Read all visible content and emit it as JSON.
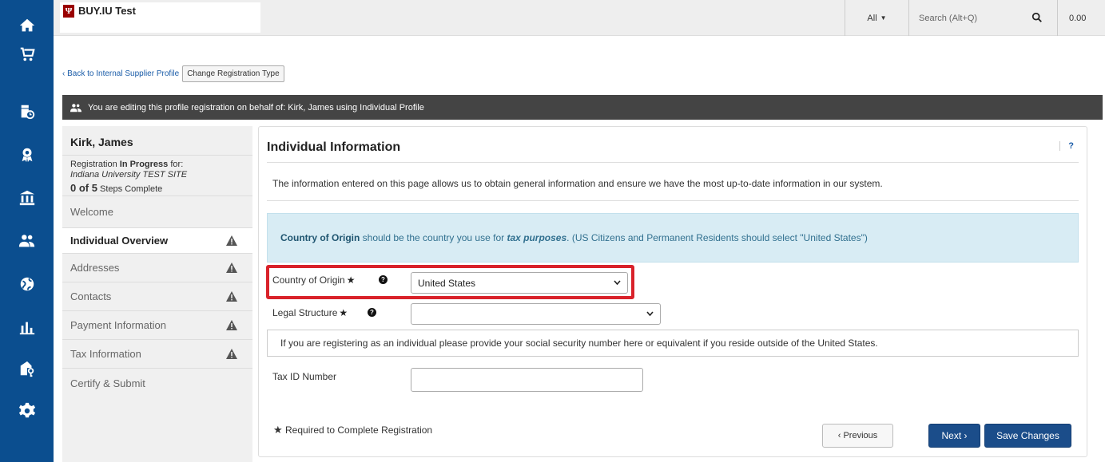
{
  "app": {
    "brand_logo": "Ψ",
    "brand_name": "BUY.IU Test"
  },
  "rail": {
    "icons": [
      "home-icon",
      "cart-icon",
      "documents-clock-icon",
      "award-icon",
      "bank-icon",
      "people-icon",
      "globe-icon",
      "bar-chart-icon",
      "building-key-icon",
      "gear-icon"
    ]
  },
  "search": {
    "scope_label": "All",
    "placeholder": "Search (Alt+Q)",
    "cart_total": "0.00"
  },
  "breadcrumb": {
    "back_label": "‹ Back to Internal Supplier Profile",
    "change_type_label": "Change Registration Type"
  },
  "banner": {
    "text": "You are editing this profile registration on behalf of: Kirk, James using Individual Profile"
  },
  "leftnav": {
    "name": "Kirk, James",
    "status_prefix": "Registration ",
    "status_bold": "In Progress",
    "status_suffix": " for:",
    "site": "Indiana University TEST SITE",
    "steps_count": "0 of 5",
    "steps_label": " Steps Complete",
    "items": [
      {
        "label": "Welcome",
        "warn": false
      },
      {
        "label": "Individual Overview",
        "warn": true
      },
      {
        "label": "Addresses",
        "warn": true
      },
      {
        "label": "Contacts",
        "warn": true
      },
      {
        "label": "Payment Information",
        "warn": true
      },
      {
        "label": "Tax Information",
        "warn": true
      },
      {
        "label": "Certify & Submit",
        "warn": false
      }
    ]
  },
  "main": {
    "title": "Individual Information",
    "help": "?",
    "intro": "The information entered on this page allows us to obtain general information and ensure we have the most up-to-date information in our system.",
    "info_bold": "Country of Origin",
    "info_mid": " should be the country you use for ",
    "info_italic": "tax purposes",
    "info_end": ". (US Citizens and Permanent Residents should select \"United States\")",
    "country_label": "Country of Origin",
    "country_value": "United States",
    "legal_label": "Legal Structure",
    "legal_value": "",
    "ssn_note": "If you are registering as an individual please provide your social security number here or equivalent if you reside outside of the United States.",
    "taxid_label": "Tax ID Number",
    "taxid_value": "",
    "required_note": "Required to Complete Registration",
    "prev_label": "‹ Previous",
    "next_label": "Next ›",
    "save_label": "Save Changes"
  },
  "colors": {
    "rail": "#0b4e8f",
    "primary_button": "#1b4d8a",
    "highlight": "#d9222a",
    "info_bg": "#d8ecf4"
  }
}
